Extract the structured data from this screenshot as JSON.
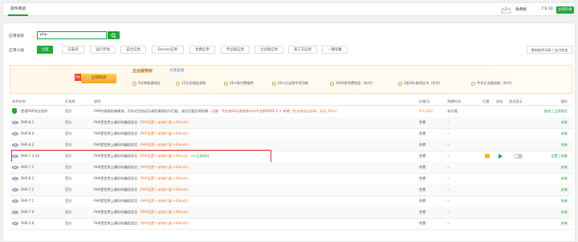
{
  "topbar": {
    "tab": "软件商店",
    "version_label": "免费版",
    "version": "7.9.10",
    "update_button": "立即升级"
  },
  "search": {
    "label": "应用搜索",
    "value": "php"
  },
  "category": {
    "label": "应用分类",
    "items": [
      "全部",
      "已安装",
      "运行环境",
      "安全应用",
      "Docker应用",
      "免费应用",
      "专业版应用",
      "企业版应用",
      "第三方应用",
      "一键部署"
    ],
    "active": 0,
    "update_list": "更新软件列表 / 支付状态"
  },
  "banner": {
    "badge": "限时",
    "buy_button": "立即购买",
    "title": "企业版特权",
    "subtitle": "点我查看",
    "features": [
      "5分钟极速响应",
      "15天无理由退款",
      "30+款付费插件",
      "20+企业版专享功能",
      "1000条免费短信（年付）",
      "2张SSL商用证书（年付）",
      "专享企业服务群（年付）"
    ]
  },
  "table": {
    "headers": [
      "软件名称",
      "开发商",
      "说明",
      "价格/天",
      "到期时间",
      "位置",
      "状态",
      "首页显示",
      "操作"
    ],
    "rows": [
      {
        "name": "堡塔PHP安全防护",
        "dev": "官方",
        "desc": "PHP内核级防御模块，可针对目前运行高危漏洞进行拦截，成功拦截后将结果…",
        "desc_red": "注意：不支持32位系统和arm平台和PHP5.2 + 新增",
        "desc_extra": "（仅支持部分版本，php_filter）",
        "price": "¥ 0.35元",
        "expire": "未开通",
        "action": "描述 | 立即购买",
        "kind": "shield"
      },
      {
        "name": "PHP-8.1",
        "dev": "官方",
        "desc": "PHP是世界上最好的编程语言",
        "tip": "（PHP设置->安装扩展->fileinfo）",
        "price": "免费",
        "expire": "--",
        "action": "安装"
      },
      {
        "name": "PHP-8.0",
        "dev": "官方",
        "desc": "PHP是世界上最好的编程语言",
        "tip": "（PHP设置->安装扩展->fileinfo）",
        "price": "免费",
        "expire": "--",
        "action": "安装"
      },
      {
        "name": "PHP-8.2",
        "dev": "官方",
        "desc": "PHP是世界上最好的编程语言",
        "tip": "（PHP设置->安装扩展->fileinfo）",
        "price": "免费",
        "expire": "--",
        "action": "安装"
      },
      {
        "name": "PHP-7.4.33",
        "dev": "官方",
        "desc": "PHP是世界上最好的编程语言",
        "tip": "（PHP设置->安装扩展->fileinfo）",
        "tip2": ">>立即前往",
        "price": "免费",
        "expire": "--",
        "action": "设置 | 卸载",
        "installed": true
      },
      {
        "name": "PHP-7.3",
        "dev": "官方",
        "desc": "PHP是世界上最好的编程语言",
        "tip": "（PHP设置->安装扩展->fileinfo）",
        "price": "免费",
        "expire": "--",
        "action": "安装"
      },
      {
        "name": "PHP-8.3",
        "dev": "官方",
        "desc": "PHP是世界上最好的编程语言",
        "tip": "（PHP设置->安装扩展->fileinfo）",
        "price": "免费",
        "expire": "--",
        "action": "安装"
      },
      {
        "name": "PHP-7.2",
        "dev": "官方",
        "desc": "PHP是世界上最好的编程语言",
        "tip": "（PHP设置->安装扩展->fileinfo）",
        "price": "免费",
        "expire": "--",
        "action": "安装"
      },
      {
        "name": "PHP-7.1",
        "dev": "官方",
        "desc": "PHP是世界上最好的编程语言",
        "tip": "（PHP设置->安装扩展->fileinfo）",
        "price": "免费",
        "expire": "--",
        "action": "安装"
      },
      {
        "name": "PHP-7.0",
        "dev": "官方",
        "desc": "PHP是世界上最好的编程语言",
        "tip": "（PHP设置->安装扩展->fileinfo）",
        "price": "免费",
        "expire": "--",
        "action": "安装"
      },
      {
        "name": "PHP-5.6",
        "dev": "官方",
        "desc": "PHP是世界上最好的编程语言",
        "tip": "（PHP设置->安装扩展->fileinfo）",
        "price": "免费",
        "expire": "--",
        "action": "安装"
      }
    ]
  }
}
